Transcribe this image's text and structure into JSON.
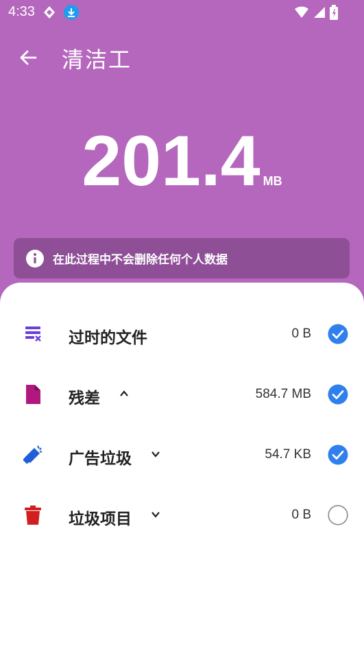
{
  "status_bar": {
    "time": "4:33"
  },
  "header": {
    "title": "清洁工"
  },
  "summary": {
    "total": "201.4",
    "unit": "MB"
  },
  "notice": {
    "text": "在此过程中不会删除任何个人数据"
  },
  "items": [
    {
      "label": "过时的文件",
      "size": "0 B",
      "checked": true,
      "icon": "obsolete-files-icon",
      "chevron": "none"
    },
    {
      "label": "残差",
      "size": "584.7 MB",
      "checked": true,
      "icon": "document-icon",
      "chevron": "up"
    },
    {
      "label": "广告垃圾",
      "size": "54.7 KB",
      "checked": true,
      "icon": "megaphone-icon",
      "chevron": "down"
    },
    {
      "label": "垃圾项目",
      "size": "0 B",
      "checked": false,
      "icon": "trash-icon",
      "chevron": "down"
    }
  ],
  "colors": {
    "accent": "#b567bd",
    "check": "#2f80ed",
    "notice_bg": "#8e4f96"
  }
}
